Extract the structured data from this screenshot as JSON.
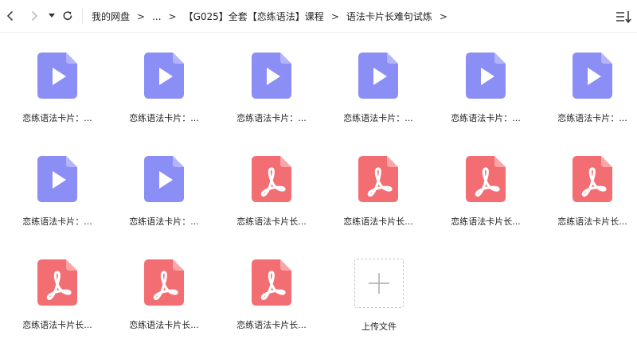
{
  "toolbar": {
    "breadcrumbs": [
      "我的网盘",
      "...",
      "【G025】全套【恋练语法】课程",
      "语法卡片长难句试炼"
    ],
    "separator": ">"
  },
  "colors": {
    "video": "#8b8ef5",
    "video_fold": "#b3b5fb",
    "pdf": "#f26e73",
    "pdf_fold": "#f9a6a9"
  },
  "files": [
    {
      "type": "video",
      "name": "恋练语法卡片：..."
    },
    {
      "type": "video",
      "name": "恋练语法卡片：..."
    },
    {
      "type": "video",
      "name": "恋练语法卡片：..."
    },
    {
      "type": "video",
      "name": "恋练语法卡片：..."
    },
    {
      "type": "video",
      "name": "恋练语法卡片：..."
    },
    {
      "type": "video",
      "name": "恋练语法卡片：..."
    },
    {
      "type": "video",
      "name": "恋练语法卡片：..."
    },
    {
      "type": "video",
      "name": "恋练语法卡片：..."
    },
    {
      "type": "pdf",
      "name": "恋练语法卡片长..."
    },
    {
      "type": "pdf",
      "name": "恋练语法卡片长..."
    },
    {
      "type": "pdf",
      "name": "恋练语法卡片长..."
    },
    {
      "type": "pdf",
      "name": "恋练语法卡片长..."
    },
    {
      "type": "pdf",
      "name": "恋练语法卡片长..."
    },
    {
      "type": "pdf",
      "name": "恋练语法卡片长..."
    },
    {
      "type": "pdf",
      "name": "恋练语法卡片长..."
    }
  ],
  "upload": {
    "label": "上传文件"
  }
}
